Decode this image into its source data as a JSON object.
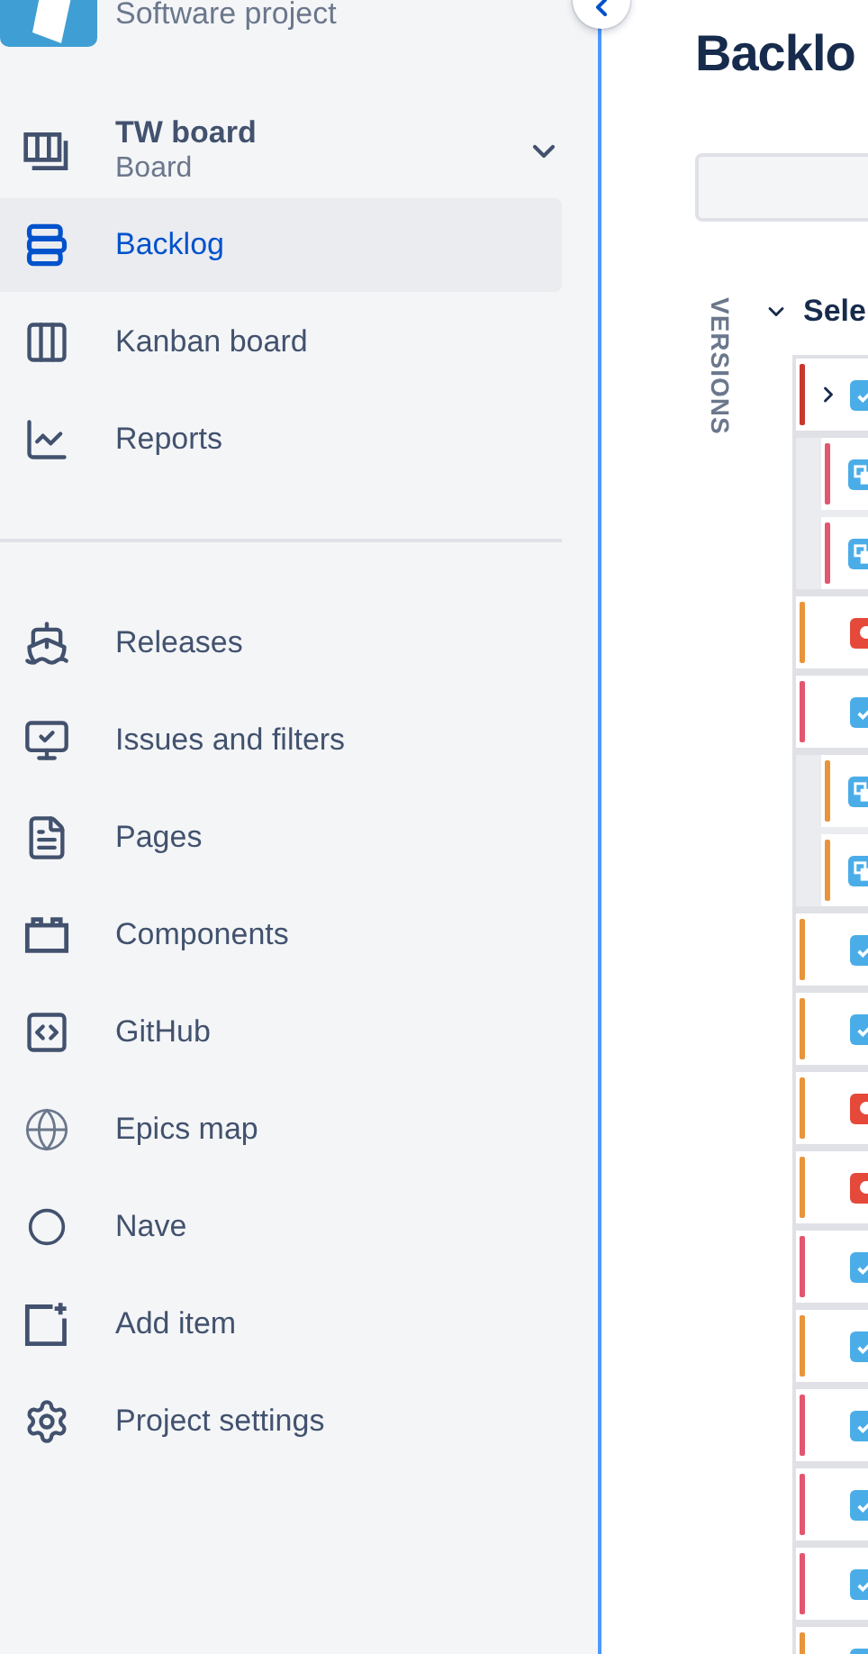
{
  "project": {
    "type": "Software project"
  },
  "board": {
    "title": "TW board",
    "subtitle": "Board",
    "expanded": true
  },
  "nav": [
    {
      "label": "Backlog",
      "selected": true
    },
    {
      "label": "Kanban board",
      "selected": false
    },
    {
      "label": "Reports",
      "selected": false
    }
  ],
  "shortcuts": [
    {
      "label": "Releases"
    },
    {
      "label": "Issues and filters"
    },
    {
      "label": "Pages"
    },
    {
      "label": "Components"
    },
    {
      "label": "GitHub"
    },
    {
      "label": "Epics map"
    },
    {
      "label": "Nave"
    },
    {
      "label": "Add item"
    },
    {
      "label": "Project settings"
    }
  ],
  "main": {
    "title": "Backlo",
    "versions_label": "VERSIONS",
    "section": {
      "title": "Sele",
      "expanded": true
    },
    "issues": [
      {
        "kind": "task",
        "color": "#c9372c",
        "collapsible": true,
        "children": [
          {
            "kind": "subtask",
            "color": "#e2566f"
          },
          {
            "kind": "subtask",
            "color": "#e2566f"
          }
        ]
      },
      {
        "kind": "bug",
        "color": "#e8943a",
        "collapsible": false
      },
      {
        "kind": "task",
        "color": "#e2566f",
        "collapsible": false,
        "children": [
          {
            "kind": "subtask",
            "color": "#e8943a"
          },
          {
            "kind": "subtask",
            "color": "#e8943a"
          }
        ]
      },
      {
        "kind": "task",
        "color": "#e8943a",
        "collapsible": false
      },
      {
        "kind": "task",
        "color": "#e8943a",
        "collapsible": false
      },
      {
        "kind": "bug",
        "color": "#e8943a",
        "collapsible": false
      },
      {
        "kind": "bug",
        "color": "#e8943a",
        "collapsible": false
      },
      {
        "kind": "task",
        "color": "#e2566f",
        "collapsible": false
      },
      {
        "kind": "task",
        "color": "#e8943a",
        "collapsible": false
      },
      {
        "kind": "task",
        "color": "#e2566f",
        "collapsible": false
      },
      {
        "kind": "task",
        "color": "#e2566f",
        "collapsible": false
      },
      {
        "kind": "task",
        "color": "#e2566f",
        "collapsible": false
      },
      {
        "kind": "task",
        "color": "#e8943a",
        "collapsible": false
      }
    ]
  }
}
